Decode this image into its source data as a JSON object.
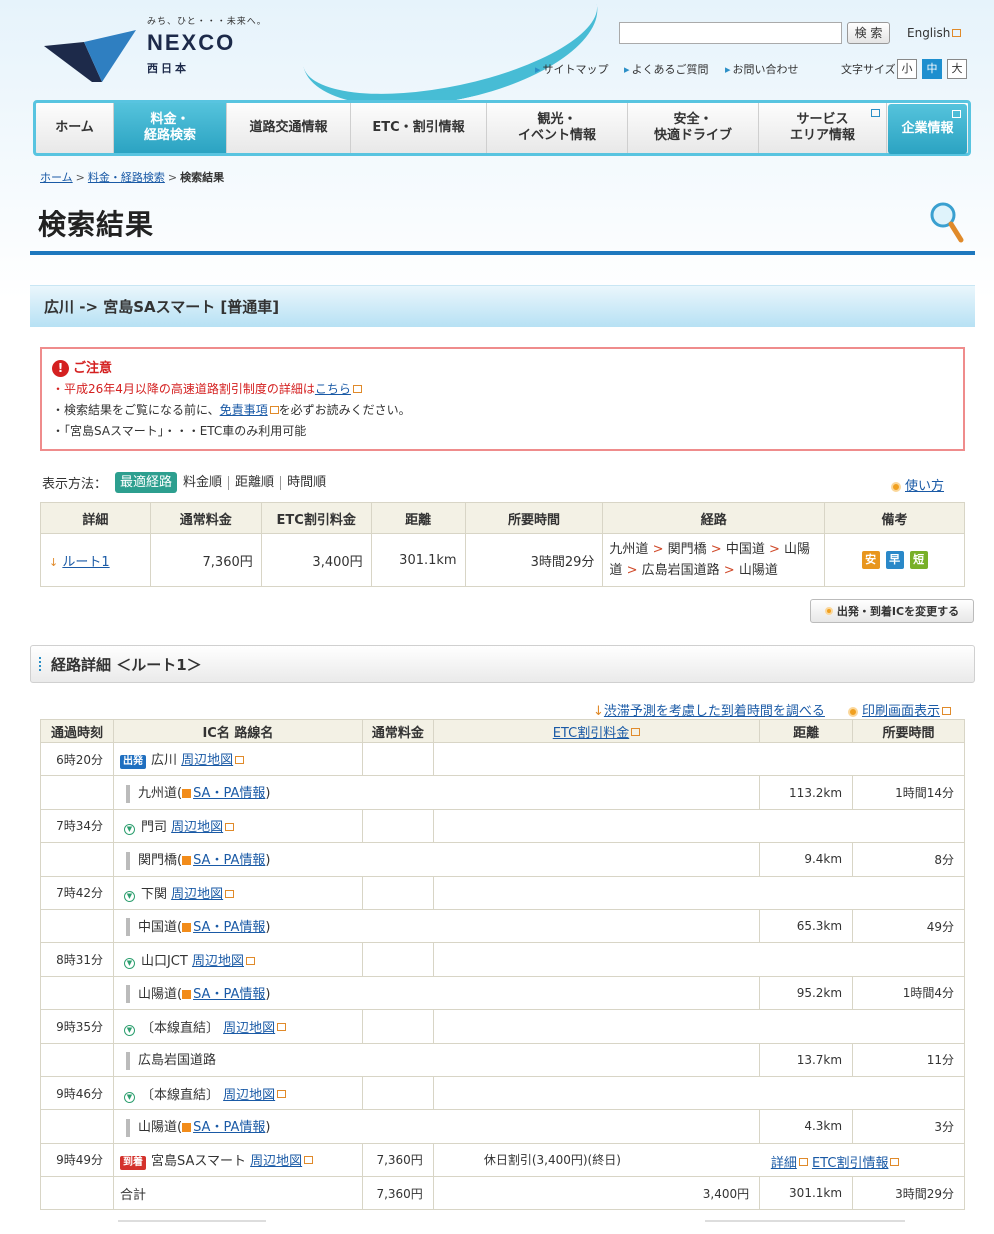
{
  "logo": {
    "tagline": "みち、ひと・・・未来へ。",
    "name": "NEXCO",
    "sub": "西日本"
  },
  "header": {
    "search_placeholder": "",
    "search_button": "検 索",
    "english": "English",
    "util_links": [
      "サイトマップ",
      "よくあるご質問",
      "お問い合わせ"
    ],
    "font_size_label": "文字サイズ",
    "font_sizes": [
      "小",
      "中",
      "大"
    ]
  },
  "nav": [
    {
      "label": "ホーム"
    },
    {
      "label": "料金・\n経路検索"
    },
    {
      "label": "道路交通情報"
    },
    {
      "label": "ETC・割引情報"
    },
    {
      "label": "観光・\nイベント情報"
    },
    {
      "label": "安全・\n快適ドライブ"
    },
    {
      "label": "サービス\nエリア情報"
    },
    {
      "label": "企業情報"
    }
  ],
  "breadcrumb": {
    "home": "ホーム",
    "search": "料金・経路検索",
    "current": "検索結果"
  },
  "page_title": "検索結果",
  "route_header": "広川 -> 宮島SAスマート [普通車]",
  "notice": {
    "title": "ご注意",
    "line1_prefix": "・平成26年4月以降の高速道路割引制度の詳細は",
    "line1_link": "こちら",
    "line2_prefix": "・検索結果をご覧になる前に、",
    "line2_link": "免責事項",
    "line2_suffix": "を必ずお読みください。",
    "line3": "・「宮島SAスマート」・・・ETC車のみ利用可能"
  },
  "sort": {
    "label": "表示方法：",
    "options": [
      "最適経路",
      "料金順",
      "距離順",
      "時間順"
    ],
    "howto": "使い方"
  },
  "results": {
    "headers": [
      "詳細",
      "通常料金",
      "ETC割引料金",
      "距離",
      "所要時間",
      "経路",
      "備考"
    ],
    "row": {
      "route": "ルート1",
      "normal_fee": "7,360円",
      "etc_fee": "3,400円",
      "distance": "301.1km",
      "time": "3時間29分",
      "path_roads": [
        "九州道",
        "関門橋",
        "中国道",
        "山陽道",
        "広島岩国道路",
        "山陽道"
      ],
      "badges": [
        "安",
        "早",
        "短"
      ]
    }
  },
  "change_ic_button": "出発・到着ICを変更する",
  "detail_title": "経路詳細 ＜ルート1＞",
  "links": {
    "traffic": "渋滞予測を考慮した到着時間を調べる",
    "print": "印刷画面表示"
  },
  "detail": {
    "headers": [
      "通過時刻",
      "IC名 路線名",
      "通常料金",
      "ETC割引料金",
      "距離",
      "所要時間"
    ],
    "map_link": "周辺地図",
    "sapa_link": "SA・PA情報",
    "depart_tag": "出発",
    "arrive_tag": "到着",
    "ics": [
      {
        "time": "6時20分",
        "name": "広川"
      },
      {
        "time": "7時34分",
        "name": "門司"
      },
      {
        "time": "7時42分",
        "name": "下関"
      },
      {
        "time": "8時31分",
        "name": "山口JCT"
      },
      {
        "time": "9時35分",
        "name": "〔本線直結〕"
      },
      {
        "time": "9時46分",
        "name": "〔本線直結〕"
      }
    ],
    "roads": [
      {
        "name": "九州道",
        "distance": "113.2km",
        "time": "1時間14分"
      },
      {
        "name": "関門橋",
        "distance": "9.4km",
        "time": "8分"
      },
      {
        "name": "中国道",
        "distance": "65.3km",
        "time": "49分"
      },
      {
        "name": "山陽道",
        "distance": "95.2km",
        "time": "1時間4分"
      },
      {
        "name": "広島岩国道路",
        "distance": "13.7km",
        "time": "11分"
      },
      {
        "name": "山陽道",
        "distance": "4.3km",
        "time": "3分"
      }
    ],
    "arrival": {
      "time": "9時49分",
      "name": "宮島SAスマート",
      "fee": "7,360円",
      "discount": "休日割引(3,400円)(終日)",
      "detail_link": "詳細",
      "etc_link": "ETC割引情報"
    },
    "total": {
      "label": "合計",
      "fee": "7,360円",
      "etc_fee": "3,400円",
      "distance": "301.1km",
      "time": "3時間29分"
    }
  }
}
